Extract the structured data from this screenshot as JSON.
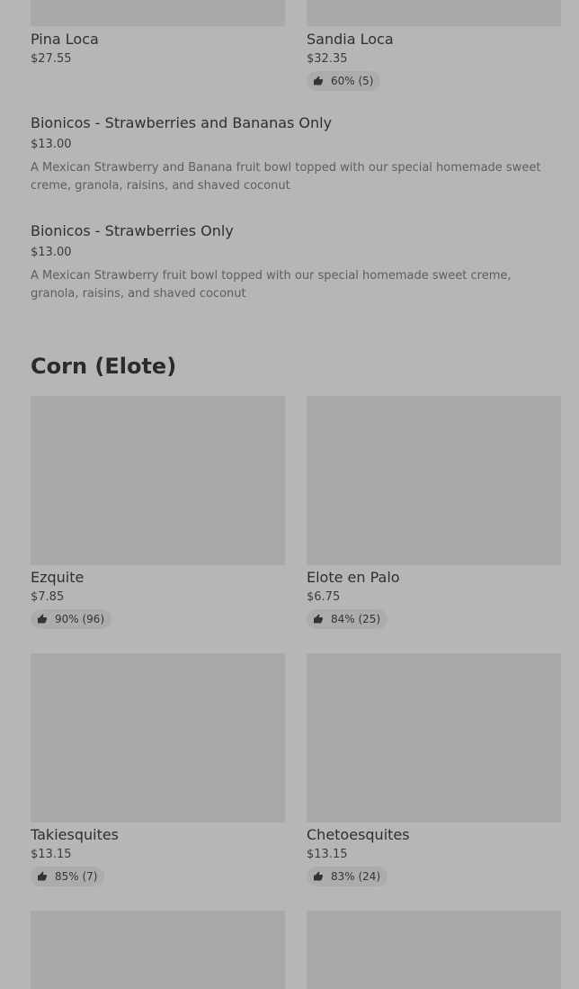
{
  "top_items": [
    {
      "name": "Pina Loca",
      "price": "$27.55"
    },
    {
      "name": "Sandia Loca",
      "price": "$32.35",
      "rating": "60% (5)"
    }
  ],
  "list_items": [
    {
      "name": "Bionicos - Strawberries and Bananas Only",
      "price": "$13.00",
      "description": "A Mexican Strawberry and Banana fruit bowl topped with our special homemade sweet creme, granola, raisins, and shaved coconut"
    },
    {
      "name": "Bionicos - Strawberries Only",
      "price": "$13.00",
      "description": "A Mexican Strawberry fruit bowl topped with our special homemade sweet creme, granola, raisins, and shaved coconut"
    }
  ],
  "section": {
    "title": "Corn (Elote)"
  },
  "corn_items": [
    {
      "name": "Ezquite",
      "price": "$7.85",
      "rating": "90% (96)"
    },
    {
      "name": "Elote en Palo",
      "price": "$6.75",
      "rating": "84% (25)"
    },
    {
      "name": "Takiesquites",
      "price": "$13.15",
      "rating": "85% (7)"
    },
    {
      "name": "Chetoesquites",
      "price": "$13.15",
      "rating": "83% (24)"
    }
  ],
  "icons": {
    "rating": "thumbs-up-icon"
  },
  "colors": {
    "background": "#b6b6b6",
    "image_placeholder": "#a9a9a9",
    "pill": "#acacac"
  }
}
